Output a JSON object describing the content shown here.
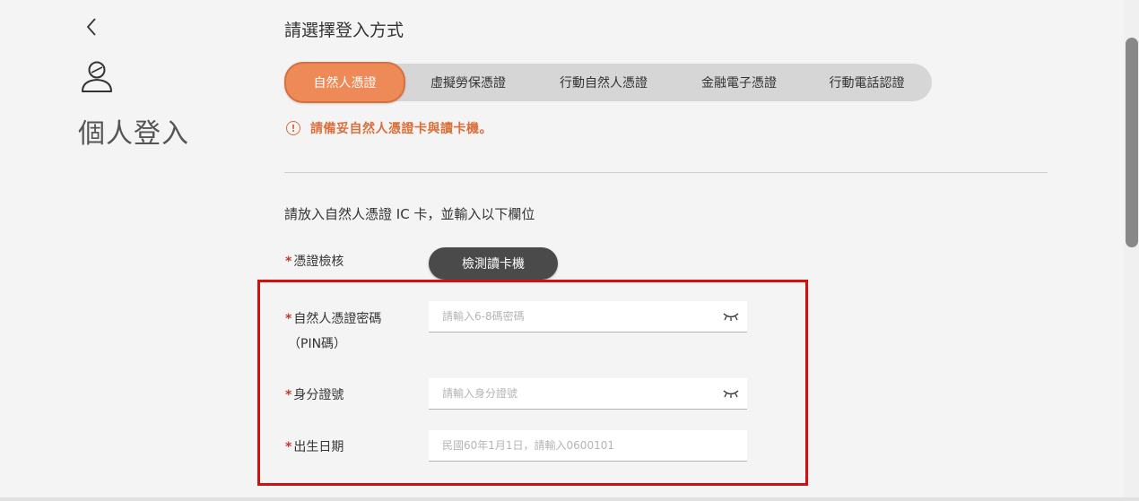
{
  "sidebar": {
    "back_icon": "chevron-left-icon",
    "person_icon": "person-icon",
    "title": "個人登入"
  },
  "main": {
    "heading": "請選擇登入方式",
    "tabs": [
      {
        "label": "自然人憑證",
        "active": true
      },
      {
        "label": "虛擬勞保憑證",
        "active": false
      },
      {
        "label": "行動自然人憑證",
        "active": false
      },
      {
        "label": "金融電子憑證",
        "active": false
      },
      {
        "label": "行動電話認證",
        "active": false
      }
    ],
    "notice": {
      "icon": "exclamation-circle-icon",
      "text": "請備妥自然人憑證卡與讀卡機。"
    },
    "instruction": "請放入自然人憑證 IC 卡，並輸入以下欄位",
    "form": {
      "required_mark": "*",
      "card_check_label": "憑證檢核",
      "detect_button": "檢測讀卡機",
      "pin_label_line1": "自然人憑證密碼",
      "pin_label_line2": "（PIN碼）",
      "pin_placeholder": "請輸入6-8碼密碼",
      "id_label": "身分證號",
      "id_placeholder": "請輸入身分證號",
      "dob_label": "出生日期",
      "dob_placeholder": "民國60年1月1日，請輸入0600101"
    }
  },
  "colors": {
    "accent": "#ee8a57",
    "notice": "#d9703b",
    "required": "#c0392b",
    "highlight": "#d20f0f",
    "button_dark": "#4a4a4a"
  }
}
